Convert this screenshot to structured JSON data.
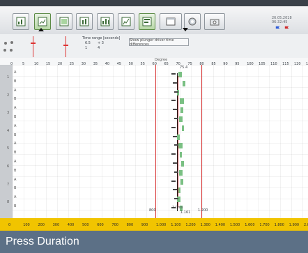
{
  "app": {
    "datetime": "26.05.2018 06:32:45",
    "show_button": "Show plunger driver time differences",
    "time_range_label": "Time range [seconds]",
    "time_range_values": [
      "6.5",
      "+ 3",
      "1",
      "4"
    ],
    "degree_label": "Degree",
    "bottom_title": "Press Duration",
    "left_small_labels": [
      "1",
      "2",
      "3",
      "4",
      "5",
      "6",
      "7",
      "8"
    ],
    "lane_labels": [
      "A",
      "B",
      "A",
      "B",
      "A",
      "B",
      "A",
      "B",
      "A",
      "B",
      "A",
      "B",
      "A",
      "B",
      "A",
      "B"
    ]
  },
  "axis": {
    "degree_ticks": [
      "0",
      "5",
      "10",
      "15",
      "20",
      "25",
      "30",
      "35",
      "40",
      "45",
      "50",
      "55",
      "60",
      "65",
      "70",
      "75",
      "80",
      "85",
      "90",
      "95",
      "100",
      "105",
      "110",
      "115",
      "120",
      "125"
    ],
    "time_ticks": [
      "0",
      "100",
      "200",
      "300",
      "400",
      "500",
      "600",
      "700",
      "800",
      "900",
      "1.000",
      "1.100",
      "1.200",
      "1.300",
      "1.400",
      "1.500",
      "1.600",
      "1.700",
      "1.800",
      "1.900",
      "2.000"
    ],
    "ref_labels": {
      "left": "800",
      "right": "1.200",
      "mid": "1.0ms",
      "top": "75.4",
      "bottom": "1.161"
    }
  },
  "colors": {
    "yellow": "#f1c400",
    "red": "#d93b3b",
    "green": "#7ac083",
    "title_bg": "#5c7086"
  }
}
